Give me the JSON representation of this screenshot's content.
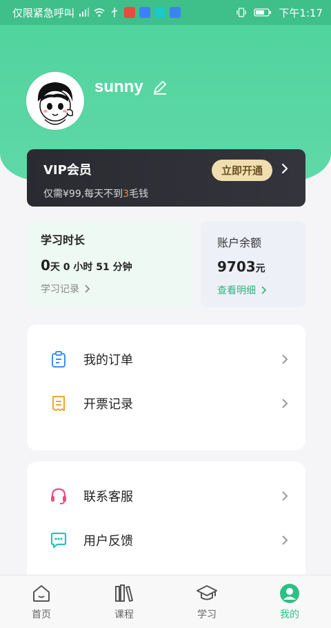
{
  "status_bar": {
    "left_text": "仅限紧急呼叫",
    "time": "下午1:17"
  },
  "profile": {
    "username": "sunny"
  },
  "vip": {
    "title": "VIP会员",
    "desc_prefix": "仅需¥99,每天不到",
    "desc_highlight": "3",
    "desc_suffix": "毛钱",
    "button_label": "立即开通"
  },
  "study": {
    "label": "学习时长",
    "days_value": "0",
    "days_unit": "天",
    "rest": "0 小时 51 分钟",
    "link": "学习记录"
  },
  "balance": {
    "label": "账户余额",
    "value": "9703",
    "unit": "元",
    "link": "查看明细"
  },
  "menu1": {
    "items": [
      {
        "label": "我的订单",
        "icon": "order-icon"
      },
      {
        "label": "开票记录",
        "icon": "invoice-icon"
      }
    ]
  },
  "menu2": {
    "items": [
      {
        "label": "联系客服",
        "icon": "headset-icon"
      },
      {
        "label": "用户反馈",
        "icon": "feedback-icon"
      }
    ]
  },
  "bottom_nav": {
    "items": [
      {
        "label": "首页",
        "icon": "home-icon"
      },
      {
        "label": "课程",
        "icon": "books-icon"
      },
      {
        "label": "学习",
        "icon": "graduation-cap-icon"
      },
      {
        "label": "我的",
        "icon": "profile-icon",
        "active": true
      }
    ]
  },
  "colors": {
    "brand_green": "#4fd39c",
    "active_green": "#2fbf86",
    "vip_bg": "#2a2b31",
    "vip_button": "#f1deae",
    "highlight_orange": "#f08a4b"
  }
}
